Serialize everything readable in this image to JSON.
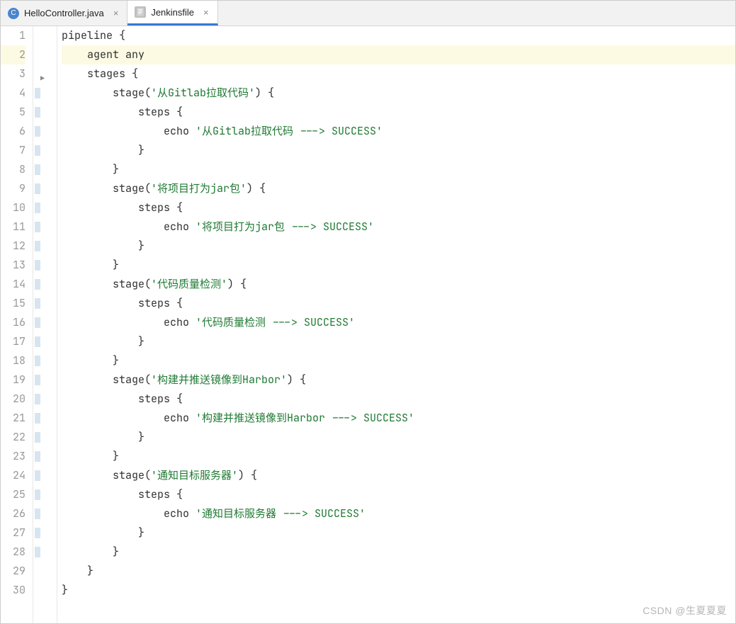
{
  "tabs": [
    {
      "label": "HelloController.java",
      "iconType": "java",
      "letter": "C",
      "active": false
    },
    {
      "label": "Jenkinsfile",
      "iconType": "text",
      "letter": "",
      "active": true
    }
  ],
  "lineCount": 30,
  "highlightLine": 2,
  "code": {
    "l1": {
      "indent": "",
      "parts": [
        {
          "t": "pipeline {",
          "c": "plain"
        }
      ]
    },
    "l2": {
      "indent": "    ",
      "parts": [
        {
          "t": "agent any",
          "c": "plain"
        }
      ]
    },
    "l3": {
      "indent": "    ",
      "parts": [
        {
          "t": "stages {",
          "c": "plain"
        }
      ]
    },
    "l4": {
      "indent": "        ",
      "parts": [
        {
          "t": "stage(",
          "c": "plain"
        },
        {
          "t": "'从Gitlab拉取代码'",
          "c": "str"
        },
        {
          "t": ") {",
          "c": "plain"
        }
      ]
    },
    "l5": {
      "indent": "            ",
      "parts": [
        {
          "t": "steps {",
          "c": "plain"
        }
      ]
    },
    "l6": {
      "indent": "                ",
      "parts": [
        {
          "t": "echo ",
          "c": "plain"
        },
        {
          "t": "'从Gitlab拉取代码 ---> SUCCESS'",
          "c": "str"
        }
      ]
    },
    "l7": {
      "indent": "            ",
      "parts": [
        {
          "t": "}",
          "c": "plain"
        }
      ]
    },
    "l8": {
      "indent": "        ",
      "parts": [
        {
          "t": "}",
          "c": "plain"
        }
      ]
    },
    "l9": {
      "indent": "        ",
      "parts": [
        {
          "t": "stage(",
          "c": "plain"
        },
        {
          "t": "'将项目打为jar包'",
          "c": "str"
        },
        {
          "t": ") {",
          "c": "plain"
        }
      ]
    },
    "l10": {
      "indent": "            ",
      "parts": [
        {
          "t": "steps {",
          "c": "plain"
        }
      ]
    },
    "l11": {
      "indent": "                ",
      "parts": [
        {
          "t": "echo ",
          "c": "plain"
        },
        {
          "t": "'将项目打为jar包 ---> SUCCESS'",
          "c": "str"
        }
      ]
    },
    "l12": {
      "indent": "            ",
      "parts": [
        {
          "t": "}",
          "c": "plain"
        }
      ]
    },
    "l13": {
      "indent": "        ",
      "parts": [
        {
          "t": "}",
          "c": "plain"
        }
      ]
    },
    "l14": {
      "indent": "        ",
      "parts": [
        {
          "t": "stage(",
          "c": "plain"
        },
        {
          "t": "'代码质量检测'",
          "c": "str"
        },
        {
          "t": ") {",
          "c": "plain"
        }
      ]
    },
    "l15": {
      "indent": "            ",
      "parts": [
        {
          "t": "steps {",
          "c": "plain"
        }
      ]
    },
    "l16": {
      "indent": "                ",
      "parts": [
        {
          "t": "echo ",
          "c": "plain"
        },
        {
          "t": "'代码质量检测 ---> SUCCESS'",
          "c": "str"
        }
      ]
    },
    "l17": {
      "indent": "            ",
      "parts": [
        {
          "t": "}",
          "c": "plain"
        }
      ]
    },
    "l18": {
      "indent": "        ",
      "parts": [
        {
          "t": "}",
          "c": "plain"
        }
      ]
    },
    "l19": {
      "indent": "        ",
      "parts": [
        {
          "t": "stage(",
          "c": "plain"
        },
        {
          "t": "'构建并推送镜像到Harbor'",
          "c": "str"
        },
        {
          "t": ") {",
          "c": "plain"
        }
      ]
    },
    "l20": {
      "indent": "            ",
      "parts": [
        {
          "t": "steps {",
          "c": "plain"
        }
      ]
    },
    "l21": {
      "indent": "                ",
      "parts": [
        {
          "t": "echo ",
          "c": "plain"
        },
        {
          "t": "'构建并推送镜像到Harbor ---> SUCCESS'",
          "c": "str"
        }
      ]
    },
    "l22": {
      "indent": "            ",
      "parts": [
        {
          "t": "}",
          "c": "plain"
        }
      ]
    },
    "l23": {
      "indent": "        ",
      "parts": [
        {
          "t": "}",
          "c": "plain"
        }
      ]
    },
    "l24": {
      "indent": "        ",
      "parts": [
        {
          "t": "stage(",
          "c": "plain"
        },
        {
          "t": "'通知目标服务器'",
          "c": "str"
        },
        {
          "t": ") {",
          "c": "plain"
        }
      ]
    },
    "l25": {
      "indent": "            ",
      "parts": [
        {
          "t": "steps {",
          "c": "plain"
        }
      ]
    },
    "l26": {
      "indent": "                ",
      "parts": [
        {
          "t": "echo ",
          "c": "plain"
        },
        {
          "t": "'通知目标服务器 ---> SUCCESS'",
          "c": "str"
        }
      ]
    },
    "l27": {
      "indent": "            ",
      "parts": [
        {
          "t": "}",
          "c": "plain"
        }
      ]
    },
    "l28": {
      "indent": "        ",
      "parts": [
        {
          "t": "}",
          "c": "plain"
        }
      ]
    },
    "l29": {
      "indent": "    ",
      "parts": [
        {
          "t": "}",
          "c": "plain"
        }
      ]
    },
    "l30": {
      "indent": "",
      "parts": [
        {
          "t": "}",
          "c": "plain"
        }
      ]
    }
  },
  "foldMarkers": [
    4,
    5,
    6,
    7,
    8,
    9,
    10,
    11,
    12,
    13,
    14,
    15,
    16,
    17,
    18,
    19,
    20,
    21,
    22,
    23,
    24,
    25,
    26,
    27,
    28
  ],
  "watermark": "CSDN @生夏夏夏"
}
